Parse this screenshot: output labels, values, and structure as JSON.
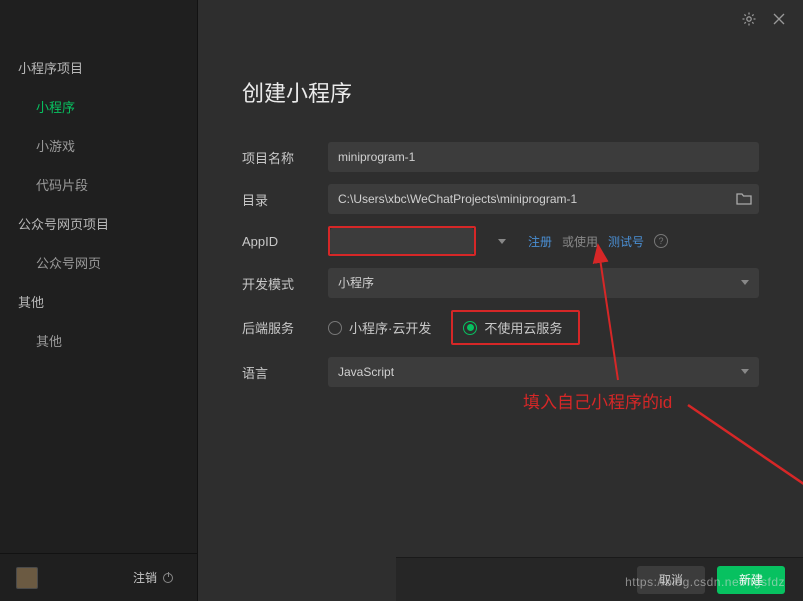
{
  "sidebar": {
    "sections": [
      {
        "header": "小程序项目",
        "items": [
          {
            "label": "小程序",
            "active": true
          },
          {
            "label": "小游戏",
            "active": false
          },
          {
            "label": "代码片段",
            "active": false
          }
        ]
      },
      {
        "header": "公众号网页项目",
        "items": [
          {
            "label": "公众号网页",
            "active": false
          }
        ]
      },
      {
        "header": "其他",
        "items": [
          {
            "label": "其他",
            "active": false
          }
        ]
      }
    ],
    "logout_label": "注销"
  },
  "page": {
    "title": "创建小程序"
  },
  "form": {
    "project_name_label": "项目名称",
    "project_name_value": "miniprogram-1",
    "directory_label": "目录",
    "directory_value": "C:\\Users\\xbc\\WeChatProjects\\miniprogram-1",
    "appid_label": "AppID",
    "appid_value": "",
    "register_link": "注册",
    "or_use_text": "或使用",
    "test_account_link": "测试号",
    "dev_mode_label": "开发模式",
    "dev_mode_value": "小程序",
    "backend_label": "后端服务",
    "backend_options": [
      {
        "label": "小程序·云开发",
        "checked": false
      },
      {
        "label": "不使用云服务",
        "checked": true
      }
    ],
    "language_label": "语言",
    "language_value": "JavaScript"
  },
  "annotation": {
    "text": "填入自己小程序的id"
  },
  "footer": {
    "cancel_label": "取消",
    "create_label": "新建"
  },
  "watermark": "https://blog.csdn.net/ltgsfdz"
}
